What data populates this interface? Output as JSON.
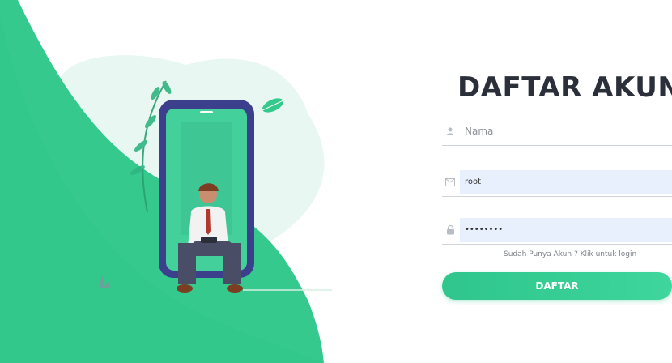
{
  "form": {
    "title": "DAFTAR AKUN",
    "fields": [
      {
        "name": "nama",
        "icon": "user-icon",
        "placeholder": "Nama",
        "value": ""
      },
      {
        "name": "email",
        "icon": "envelope-icon",
        "placeholder": "",
        "value": "root"
      },
      {
        "name": "password",
        "icon": "lock-icon",
        "placeholder": "",
        "value": "••••••••"
      }
    ],
    "login_hint": "Sudah Punya Akun ? Klik untuk login",
    "submit_label": "DAFTAR"
  },
  "colors": {
    "accent": "#2fc58c",
    "accent_dark": "#1fb57a",
    "phone": "#3b3f8c",
    "title": "#2b2f3a",
    "input_fill": "#e8f0fe"
  },
  "illustration": {
    "icon": "person-with-phone-illustration"
  }
}
